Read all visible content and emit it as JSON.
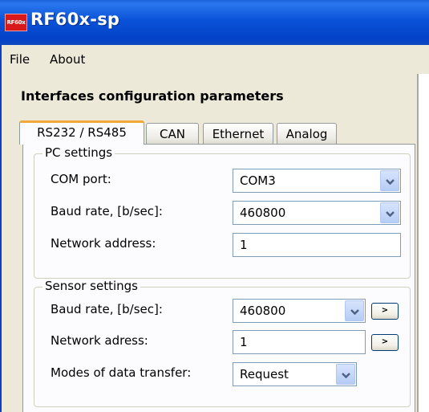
{
  "window": {
    "title": "RF60x-sp",
    "logo_text": "RF60x"
  },
  "menu": {
    "items": [
      "File",
      "About"
    ]
  },
  "main": {
    "heading": "Interfaces configuration parameters",
    "tabs": [
      {
        "label": "RS232 / RS485",
        "active": true
      },
      {
        "label": "CAN",
        "active": false
      },
      {
        "label": "Ethernet",
        "active": false
      },
      {
        "label": "Analog",
        "active": false
      }
    ]
  },
  "pc_settings": {
    "title": "PC settings",
    "com_port_label": "COM port:",
    "com_port_value": "COM3",
    "baud_label": "Baud rate, [b/sec]:",
    "baud_value": "460800",
    "address_label": "Network address:",
    "address_value": "1"
  },
  "sensor_settings": {
    "title": "Sensor settings",
    "baud_label": "Baud rate, [b/sec]:",
    "baud_value": "460800",
    "baud_button": ">",
    "address_label": "Network adress:",
    "address_value": "1",
    "address_button": ">",
    "mode_label": "Modes of data transfer:",
    "mode_value": "Request"
  },
  "icons": {
    "dropdown": "chevron-down-icon"
  },
  "colors": {
    "titlebar": "#0a52d8",
    "active_tab_accent": "#f1a83a",
    "dialog_face": "#ece9d8",
    "field_border": "#7f9db9"
  }
}
